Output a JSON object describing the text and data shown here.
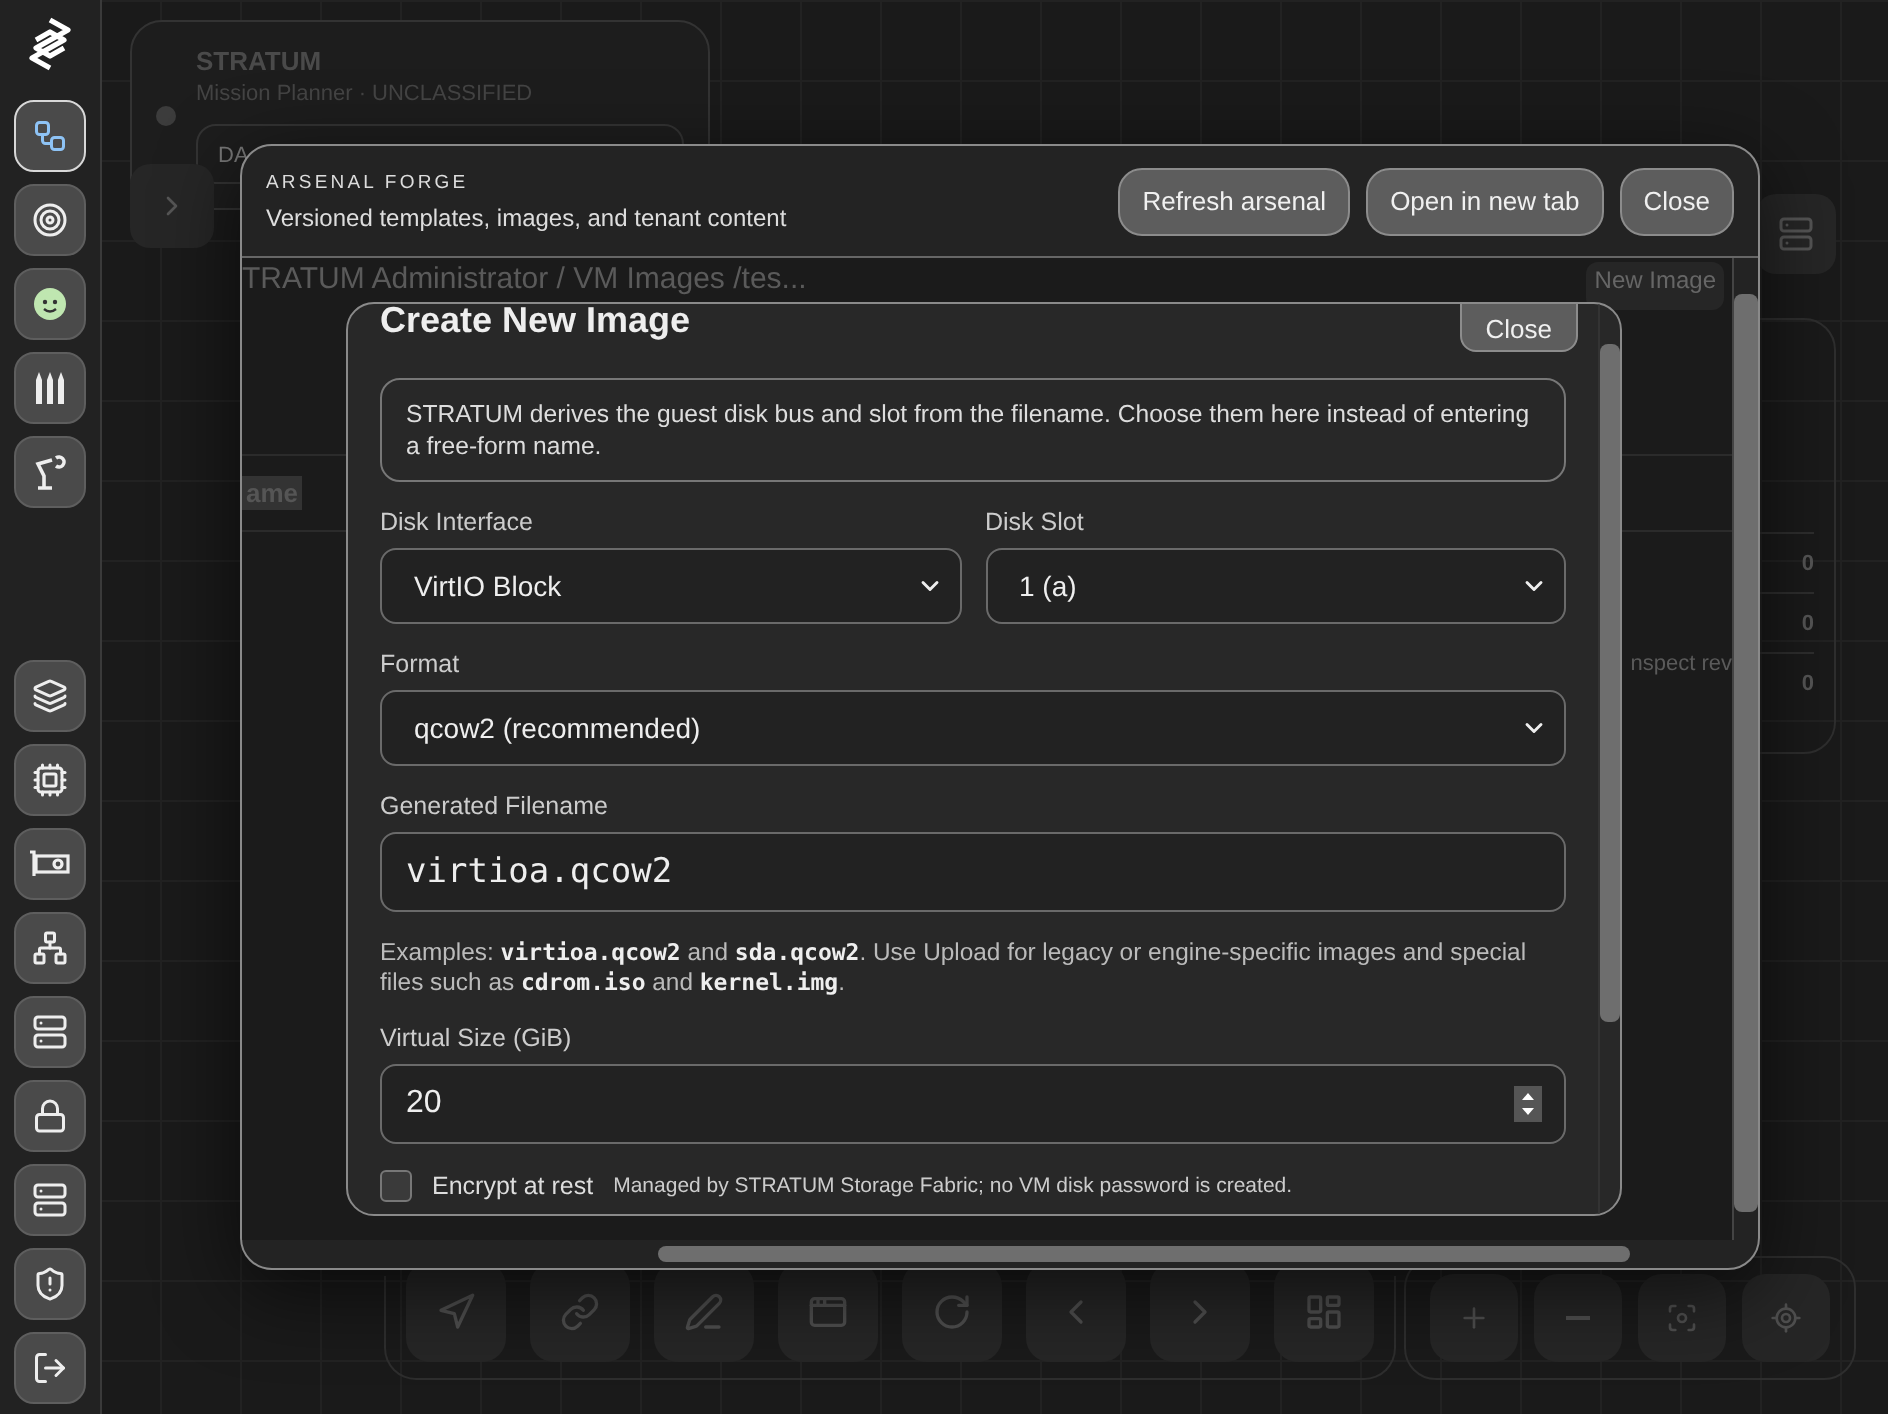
{
  "sidebar": {
    "items": [
      {
        "selected": true
      },
      {
        "selected": false
      },
      {
        "selected": false
      },
      {
        "selected": false
      },
      {
        "selected": false
      },
      {
        "selected": false
      },
      {
        "selected": false
      },
      {
        "selected": false
      },
      {
        "selected": false
      },
      {
        "selected": false
      },
      {
        "selected": false
      },
      {
        "selected": false
      },
      {
        "selected": false
      },
      {
        "selected": false
      }
    ]
  },
  "app_header": {
    "title": "STRATUM",
    "subtitle": "Mission Planner · UNCLASSIFIED",
    "field": "DA"
  },
  "counts": [
    "0",
    "0",
    "0"
  ],
  "forge": {
    "eyebrow": "ARSENAL FORGE",
    "subtitle": "Versioned templates, images, and tenant content",
    "buttons": [
      "Refresh arsenal",
      "Open in new tab",
      "Close"
    ],
    "page": {
      "breadcrumb": "TRATUM Administrator / VM Images /tes...",
      "toolbar_button": "New Image",
      "column_header": "ame",
      "row_text": "nspect rev"
    }
  },
  "dialog": {
    "title": "Create New Image",
    "close": "Close",
    "note": "STRATUM derives the guest disk bus and slot from the filename. Choose them here instead of entering a free-form name.",
    "disk_interface": {
      "label": "Disk Interface",
      "value": "VirtIO Block"
    },
    "disk_slot": {
      "label": "Disk Slot",
      "value": "1 (a)"
    },
    "format": {
      "label": "Format",
      "value": "qcow2 (recommended)"
    },
    "filename": {
      "label": "Generated Filename",
      "value": "virtioa.qcow2"
    },
    "hint": [
      {
        "kind": "text",
        "text": "Examples: "
      },
      {
        "kind": "code",
        "text": "virtioa.qcow2"
      },
      {
        "kind": "text",
        "text": " and "
      },
      {
        "kind": "code",
        "text": "sda.qcow2"
      },
      {
        "kind": "text",
        "text": ". Use Upload for legacy or engine-specific images and special files such as "
      },
      {
        "kind": "code",
        "text": "cdrom.iso"
      },
      {
        "kind": "text",
        "text": " and "
      },
      {
        "kind": "code",
        "text": "kernel.img"
      },
      {
        "kind": "text",
        "text": "."
      }
    ],
    "virtual_size": {
      "label": "Virtual Size (GiB)",
      "value": "20"
    },
    "encrypt": {
      "label": "Encrypt at rest",
      "checked": false,
      "note": "Managed by STRATUM Storage Fabric; no VM disk password is created."
    }
  }
}
